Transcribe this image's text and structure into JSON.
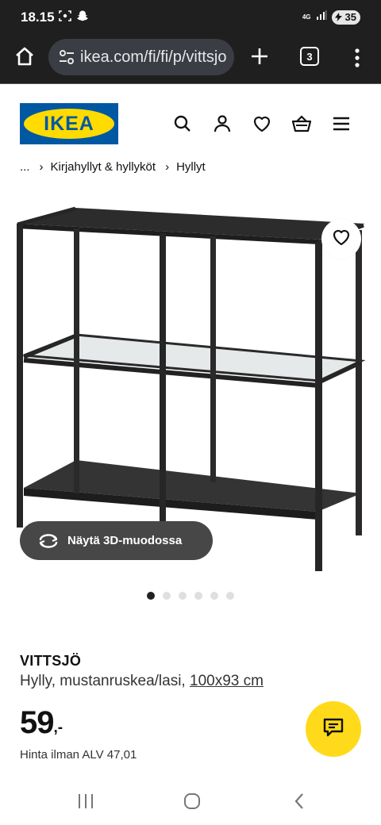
{
  "status_bar": {
    "time": "18.15",
    "network": "4G",
    "battery": "35",
    "icons": [
      "screenshot-icon",
      "snapchat-icon",
      "network-4g-icon",
      "signal-icon",
      "battery-icon"
    ]
  },
  "browser": {
    "url": "ikea.com/fi/fi/p/vittsjo",
    "tab_count": "3",
    "icons": [
      "home-icon",
      "site-settings-icon",
      "plus-icon",
      "tab-switcher-icon",
      "more-vert-icon"
    ]
  },
  "header": {
    "logo_text": "IKEA",
    "icons": [
      "search-icon",
      "account-icon",
      "heart-icon",
      "basket-icon",
      "menu-icon"
    ],
    "brand_colors": {
      "blue": "#0058a3",
      "yellow": "#ffdb00"
    }
  },
  "breadcrumb": {
    "items": [
      "...",
      "Kirjahyllyt & hyllyköt",
      "Hyllyt"
    ],
    "separator": "›"
  },
  "product_image": {
    "view_3d_label": "Näytä 3D-muodossa",
    "carousel": {
      "total": 6,
      "active_index": 0
    }
  },
  "product": {
    "name": "VITTSJÖ",
    "description": "Hylly, mustanruskea/lasi, ",
    "size": "100x93 cm",
    "price": "59",
    "price_suffix": ",-",
    "vat_text": "Hinta ilman ALV 47,01"
  },
  "chat": {
    "icon": "chat-icon",
    "color": "#ffda1a"
  },
  "nav": {
    "icons": [
      "recents-icon",
      "home-circle-icon",
      "back-icon"
    ]
  }
}
